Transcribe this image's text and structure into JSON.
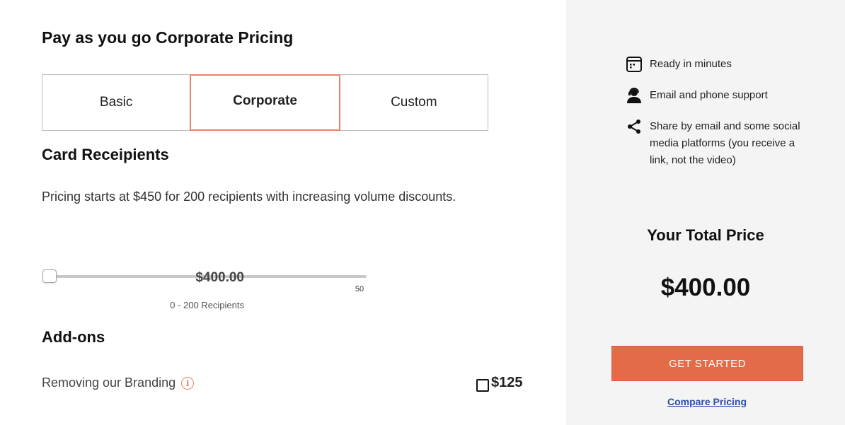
{
  "page_title": "Pay as you go Corporate Pricing",
  "plans": [
    {
      "label": "Basic",
      "selected": false
    },
    {
      "label": "Corporate",
      "selected": true
    },
    {
      "label": "Custom",
      "selected": false
    }
  ],
  "recipients": {
    "heading": "Card Receipients",
    "description": "Pricing starts at $450 for 200 recipients with increasing volume discounts.",
    "slider_value": "50",
    "price": "$400.00",
    "range_text": "0 - 200 Recipients"
  },
  "addons": {
    "heading": "Add-ons",
    "items": [
      {
        "label": "Removing our Branding",
        "price": "$125",
        "checked": false
      }
    ]
  },
  "sidebar": {
    "features": [
      {
        "icon": "calendar-icon",
        "text": "Ready in minutes"
      },
      {
        "icon": "support-agent-icon",
        "text": "Email and phone support"
      },
      {
        "icon": "share-icon",
        "text": "Share by email and some social media platforms (you receive a link, not the video)"
      }
    ],
    "total_label": "Your Total Price",
    "total_price": "$400.00",
    "cta_label": "GET STARTED",
    "compare_label": "Compare Pricing"
  },
  "colors": {
    "accent": "#e46b47",
    "accent_border": "#e6836a",
    "link": "#2a4fa8",
    "sidebar_bg": "#f4f4f4"
  }
}
